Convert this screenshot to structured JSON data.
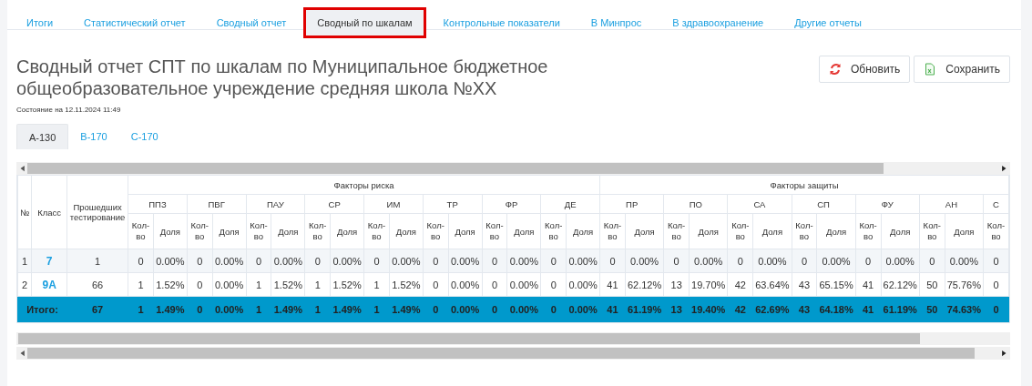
{
  "tabs": [
    {
      "label": "Итоги",
      "selected": false
    },
    {
      "label": "Статистический отчет",
      "selected": false
    },
    {
      "label": "Сводный отчет",
      "selected": false
    },
    {
      "label": "Сводный по шкалам",
      "selected": true
    },
    {
      "label": "Контрольные показатели",
      "selected": false
    },
    {
      "label": "В Минпрос",
      "selected": false
    },
    {
      "label": "В здравоохранение",
      "selected": false
    },
    {
      "label": "Другие отчеты",
      "selected": false
    }
  ],
  "title": "Сводный отчет СПТ по шкалам по Муниципальное бюджетное общеобразовательное учреждение средняя школа №XX",
  "status_text": "Состояние на 12.11.2024 11:49",
  "buttons": [
    {
      "label": "Обновить",
      "kind": "refresh"
    },
    {
      "label": "Сохранить",
      "kind": "save"
    }
  ],
  "scale_tabs": [
    {
      "label": "A-130",
      "selected": true
    },
    {
      "label": "B-170",
      "selected": false
    },
    {
      "label": "C-170",
      "selected": false
    }
  ],
  "table": {
    "columns": {
      "number": "№",
      "class": "Класс",
      "tested": "Прошедших тестирование"
    },
    "groups": [
      {
        "title": "Факторы риска",
        "scales": [
          {
            "name": "ППЗ",
            "count_header": "Кол-во",
            "share_header": "Доля"
          },
          {
            "name": "ПВГ",
            "count_header": "Кол-во",
            "share_header": "Доля"
          },
          {
            "name": "ПАУ",
            "count_header": "Кол-во",
            "share_header": "Доля"
          },
          {
            "name": "СР",
            "count_header": "Кол-во",
            "share_header": "Доля"
          },
          {
            "name": "ИМ",
            "count_header": "Кол-во",
            "share_header": "Доля"
          },
          {
            "name": "ТР",
            "count_header": "Кол-во",
            "share_header": "Доля"
          },
          {
            "name": "ФР",
            "count_header": "Кол-во",
            "share_header": "Доля"
          },
          {
            "name": "ДЕ",
            "count_header": "Кол-во",
            "share_header": "Доля"
          }
        ]
      },
      {
        "title": "Факторы защиты",
        "scales": [
          {
            "name": "ПР",
            "count_header": "Кол-во",
            "share_header": "Доля"
          },
          {
            "name": "ПО",
            "count_header": "Кол-во",
            "share_header": "Доля"
          },
          {
            "name": "СА",
            "count_header": "Кол-во",
            "share_header": "Доля"
          },
          {
            "name": "СП",
            "count_header": "Кол-во",
            "share_header": "Доля"
          },
          {
            "name": "ФУ",
            "count_header": "Кол-во",
            "share_header": "Доля"
          },
          {
            "name": "АН",
            "count_header": "Кол-во",
            "share_header": "Доля"
          },
          {
            "name": "С",
            "count_header": "Кол-во"
          }
        ]
      }
    ],
    "rows": [
      {
        "number": "1",
        "class": "7",
        "tested": "1",
        "cells": [
          {
            "count": "0",
            "share": "0.00%"
          },
          {
            "count": "0",
            "share": "0.00%"
          },
          {
            "count": "0",
            "share": "0.00%"
          },
          {
            "count": "0",
            "share": "0.00%"
          },
          {
            "count": "0",
            "share": "0.00%"
          },
          {
            "count": "0",
            "share": "0.00%"
          },
          {
            "count": "0",
            "share": "0.00%"
          },
          {
            "count": "0",
            "share": "0.00%"
          },
          {
            "count": "0",
            "share": "0.00%"
          },
          {
            "count": "0",
            "share": "0.00%"
          },
          {
            "count": "0",
            "share": "0.00%"
          },
          {
            "count": "0",
            "share": "0.00%"
          },
          {
            "count": "0",
            "share": "0.00%"
          },
          {
            "count": "0",
            "share": "0.00%"
          },
          {
            "count": "0"
          }
        ]
      },
      {
        "number": "2",
        "class": "9А",
        "tested": "66",
        "cells": [
          {
            "count": "1",
            "share": "1.52%"
          },
          {
            "count": "0",
            "share": "0.00%"
          },
          {
            "count": "1",
            "share": "1.52%"
          },
          {
            "count": "1",
            "share": "1.52%"
          },
          {
            "count": "1",
            "share": "1.52%"
          },
          {
            "count": "0",
            "share": "0.00%"
          },
          {
            "count": "0",
            "share": "0.00%"
          },
          {
            "count": "0",
            "share": "0.00%"
          },
          {
            "count": "41",
            "share": "62.12%"
          },
          {
            "count": "13",
            "share": "19.70%"
          },
          {
            "count": "42",
            "share": "63.64%"
          },
          {
            "count": "43",
            "share": "65.15%"
          },
          {
            "count": "41",
            "share": "62.12%"
          },
          {
            "count": "50",
            "share": "75.76%"
          },
          {
            "count": "0"
          }
        ]
      }
    ],
    "total": {
      "label": "Итого:",
      "tested": "67",
      "cells": [
        {
          "count": "1",
          "share": "1.49%"
        },
        {
          "count": "0",
          "share": "0.00%"
        },
        {
          "count": "1",
          "share": "1.49%"
        },
        {
          "count": "1",
          "share": "1.49%"
        },
        {
          "count": "1",
          "share": "1.49%"
        },
        {
          "count": "0",
          "share": "0.00%"
        },
        {
          "count": "0",
          "share": "0.00%"
        },
        {
          "count": "0",
          "share": "0.00%"
        },
        {
          "count": "41",
          "share": "61.19%"
        },
        {
          "count": "13",
          "share": "19.40%"
        },
        {
          "count": "42",
          "share": "62.69%"
        },
        {
          "count": "43",
          "share": "64.18%"
        },
        {
          "count": "41",
          "share": "61.19%"
        },
        {
          "count": "50",
          "share": "74.63%"
        },
        {
          "count": "0"
        }
      ]
    }
  }
}
